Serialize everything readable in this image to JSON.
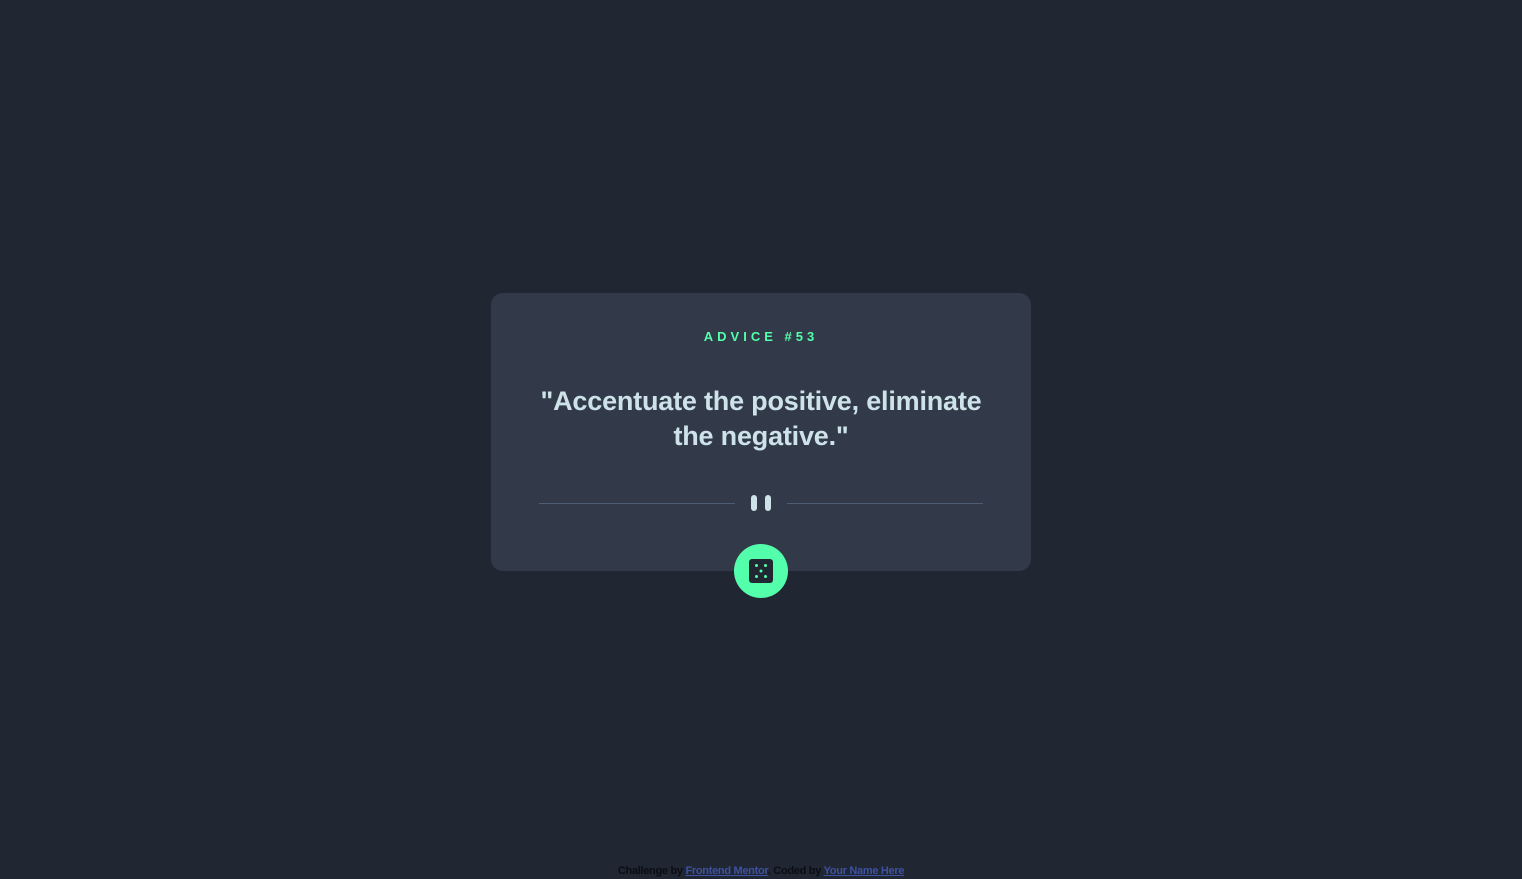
{
  "advice": {
    "label": "ADVICE #53",
    "quote": "\"Accentuate the positive, eliminate the negative.\""
  },
  "controls": {
    "generate_icon": "dice-icon",
    "divider_icon": "pause-icon"
  },
  "footer": {
    "challenge_prefix": "Challenge by",
    "challenge_link": "Frontend Mentor",
    "separator": ".",
    "coded_prefix": "Coded by",
    "coded_link": "Your Name Here"
  },
  "colors": {
    "background": "#202632",
    "card": "#323a49",
    "accent": "#53ffaa",
    "text": "#cee3e9",
    "divider": "#4f5d74",
    "link": "#3e52a3"
  }
}
